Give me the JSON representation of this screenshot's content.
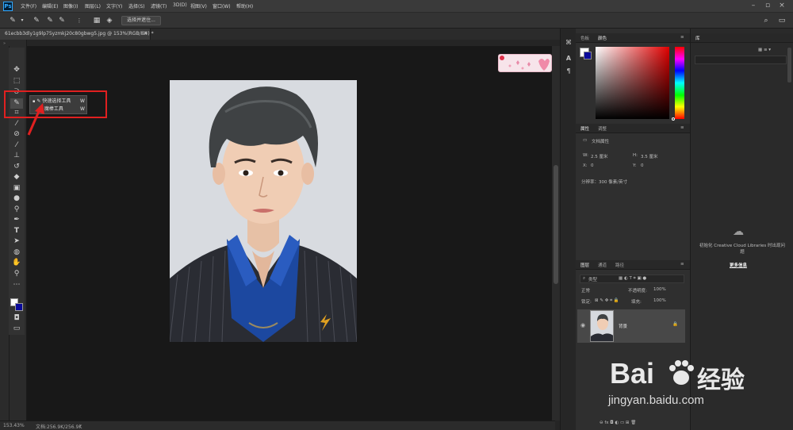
{
  "app": {
    "name": "Ps"
  },
  "menubar": {
    "items": [
      "文件(F)",
      "编辑(E)",
      "图像(I)",
      "图层(L)",
      "文字(Y)",
      "选择(S)",
      "滤镜(T)",
      "3D(D)",
      "视图(V)",
      "窗口(W)",
      "帮助(H)"
    ]
  },
  "options": {
    "select_subject_label": "选择并遮住..."
  },
  "document": {
    "tab_label": "61ecbb3dly1g9lp75yzmkj20c80gbwg5.jpg @ 153%(RGB/8#) *",
    "tab_close": "×"
  },
  "flyout": {
    "items": [
      {
        "label": "快速选择工具",
        "shortcut": "W"
      },
      {
        "label": "魔棒工具",
        "shortcut": "W"
      }
    ]
  },
  "statusbar": {
    "zoom": "153.43%",
    "doc_info": "文档:256.9K/256.9K"
  },
  "panels": {
    "color": {
      "tabs": [
        "色板",
        "颜色"
      ],
      "active_tab": "颜色"
    },
    "properties": {
      "tabs": [
        "属性",
        "调整"
      ],
      "title": "文档属性",
      "w_label": "W:",
      "w_value": "2.5 厘米",
      "h_label": "H:",
      "h_value": "3.5 厘米",
      "x_label": "X:",
      "x_value": "0",
      "y_label": "Y:",
      "y_value": "0",
      "resolution": "分辨率：300 像素/英寸"
    },
    "layers": {
      "tabs": [
        "图层",
        "通道",
        "路径"
      ],
      "filter_label": "类型",
      "blend_mode": "正常",
      "opacity_label": "不透明度:",
      "opacity_value": "100%",
      "lock_label": "锁定:",
      "fill_label": "填充:",
      "fill_value": "100%",
      "layer_name": "背景"
    },
    "libraries": {
      "tab": "库",
      "message": "初始化 Creative Cloud Libraries 时出现问题",
      "more_info": "更多信息"
    }
  },
  "watermark": {
    "brand": "Bai",
    "brand_cn": "经验",
    "url": "jingyan.baidu.com"
  },
  "colors": {
    "accent_red": "#e02020",
    "ps_blue": "#31a8ff",
    "panel_bg": "#2f2f2f"
  }
}
